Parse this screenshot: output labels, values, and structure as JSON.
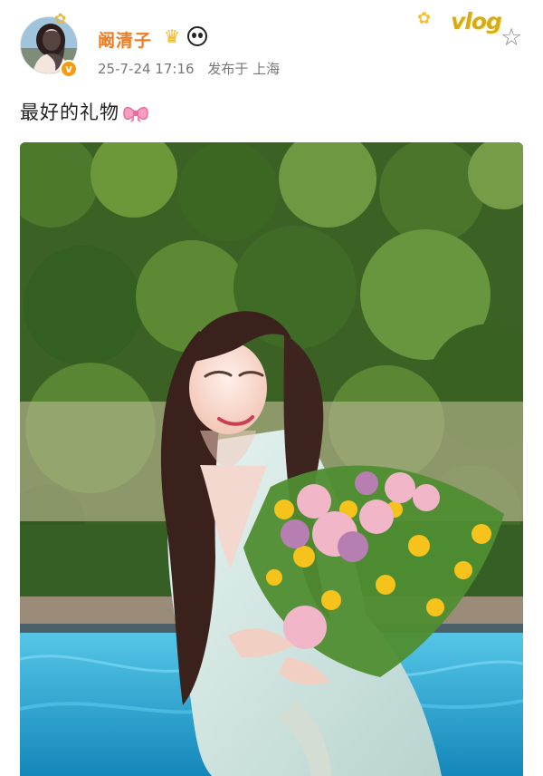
{
  "user": {
    "name": "阚清子",
    "crown_icon": "crown-icon",
    "panda_icon": "panda-icon",
    "verified_icon": "verified-badge-icon",
    "verified_glyph": "v"
  },
  "post": {
    "time": "25-7-24 17:16",
    "source": "发布于 上海",
    "text": "最好的礼物",
    "emoji": "bow-icon"
  },
  "vlog_badge": "vlog",
  "colors": {
    "username": "#f07b21",
    "meta": "#777777",
    "accent": "#f59b12"
  }
}
